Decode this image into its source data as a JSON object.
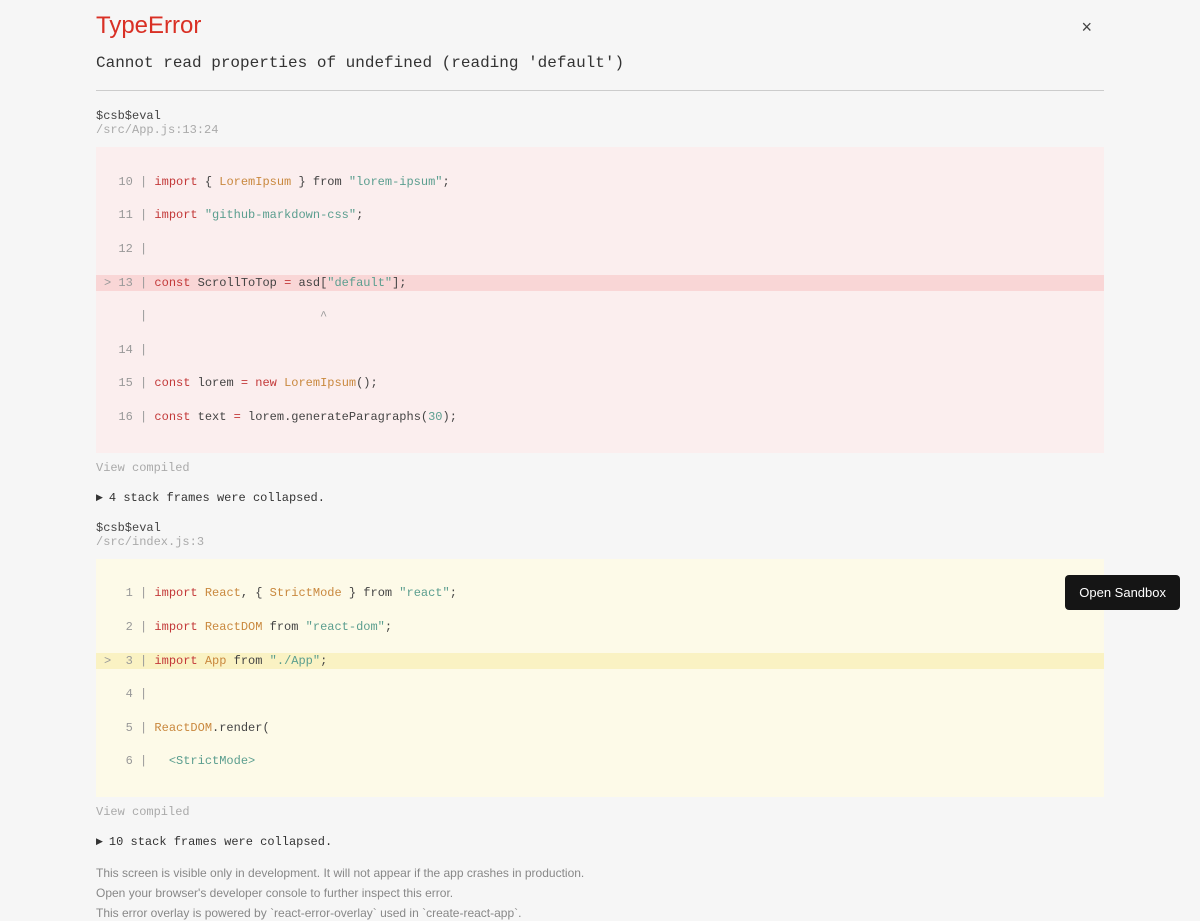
{
  "error": {
    "title": "TypeError",
    "message": "Cannot read properties of undefined (reading 'default')"
  },
  "close_label": "×",
  "frame1": {
    "label": "$csb$eval",
    "location": "/src/App.js:13:24",
    "view_compiled": "View compiled"
  },
  "collapsed1": "4 stack frames were collapsed.",
  "frame2": {
    "label": "$csb$eval",
    "location": "/src/index.js:3",
    "view_compiled": "View compiled"
  },
  "collapsed2": "10 stack frames were collapsed.",
  "footer": {
    "l1": "This screen is visible only in development. It will not appear if the app crashes in production.",
    "l2": "Open your browser's developer console to further inspect this error.",
    "l3": "This error overlay is powered by `react-error-overlay` used in `create-react-app`."
  },
  "sandbox_button": "Open Sandbox",
  "code1": {
    "l10a": "  10 | ",
    "l10_kw": "import",
    "l10b": " { ",
    "l10_cls": "LoremIpsum",
    "l10c": " } from ",
    "l10_str": "\"lorem-ipsum\"",
    "l10d": ";",
    "l11a": "  11 | ",
    "l11_kw": "import",
    "l11b": " ",
    "l11_str": "\"github-markdown-css\"",
    "l11c": ";",
    "l12a": "  12 | ",
    "l13a": "> 13 | ",
    "l13_kw": "const",
    "l13b": " ScrollToTop ",
    "l13_op": "=",
    "l13c": " asd[",
    "l13_str": "\"default\"",
    "l13d": "];",
    "lcar": "     |                        ^",
    "l14a": "  14 | ",
    "l15a": "  15 | ",
    "l15_kw": "const",
    "l15b": " lorem ",
    "l15_op": "=",
    "l15c": " ",
    "l15_kw2": "new",
    "l15d": " ",
    "l15_cls": "LoremIpsum",
    "l15e": "();",
    "l16a": "  16 | ",
    "l16_kw": "const",
    "l16b": " text ",
    "l16_op": "=",
    "l16c": " lorem.generateParagraphs(",
    "l16_num": "30",
    "l16d": ");"
  },
  "code2": {
    "l1a": "   1 | ",
    "l1_kw": "import",
    "l1b": " ",
    "l1_cls": "React",
    "l1c": ", { ",
    "l1_cls2": "StrictMode",
    "l1d": " } from ",
    "l1_str": "\"react\"",
    "l1e": ";",
    "l2a": "   2 | ",
    "l2_kw": "import",
    "l2b": " ",
    "l2_cls": "ReactDOM",
    "l2c": " from ",
    "l2_str": "\"react-dom\"",
    "l2d": ";",
    "l3a": ">  3 | ",
    "l3_kw": "import",
    "l3b": " ",
    "l3_cls": "App",
    "l3c": " from ",
    "l3_str": "\"./App\"",
    "l3d": ";",
    "l4a": "   4 | ",
    "l5a": "   5 | ",
    "l5_cls": "ReactDOM",
    "l5b": ".render(",
    "l6a": "   6 |   ",
    "l6_tag": "<StrictMode>"
  }
}
